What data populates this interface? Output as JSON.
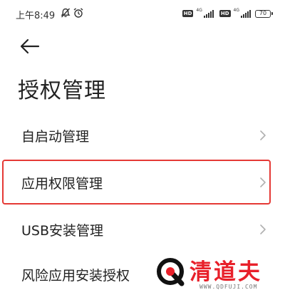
{
  "status_bar": {
    "time": "上午8:49",
    "left_icons": [
      "mute-icon",
      "alarm-icon"
    ],
    "sim1": {
      "badge": "HD",
      "network": "4G"
    },
    "sim2": {
      "badge": "HD",
      "network": "4G"
    },
    "battery": "70"
  },
  "header": {
    "back_icon": "arrow-left-icon",
    "title": "授权管理"
  },
  "menu": {
    "items": [
      {
        "label": "自启动管理"
      },
      {
        "label": "应用权限管理",
        "highlighted": true
      },
      {
        "label": "USB安装管理"
      },
      {
        "label": "风险应用安装授权"
      }
    ]
  },
  "watermark": {
    "brand": "清道夫",
    "url": "WWW.QDFUJI.COM"
  },
  "colors": {
    "highlight": "#e53935",
    "watermark": "#e8202a",
    "text": "#222222",
    "chevron": "#b0b0b0"
  }
}
